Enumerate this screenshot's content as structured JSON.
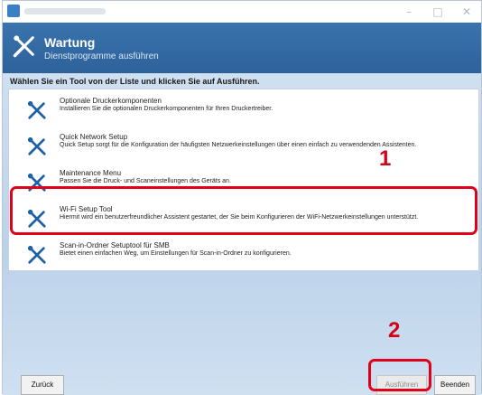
{
  "window": {
    "title": "",
    "minimize": "–",
    "maximize": "□",
    "close": "✕"
  },
  "header": {
    "title": "Wartung",
    "subtitle": "Dienstprogramme ausführen",
    "icon": "wrench-screwdriver-icon"
  },
  "prompt": "Wählen Sie ein Tool von der Liste und klicken Sie auf Ausführen.",
  "tools": [
    {
      "name": "Optionale Druckerkomponenten",
      "desc": "Installieren Sie die optionalen Druckerkomponenten für Ihren Druckertreiber."
    },
    {
      "name": "Quick Network Setup",
      "desc": "Quick Setup sorgt für die Konfiguration der häufigsten Netzwerkeinstellungen über einen einfach zu verwendenden Assistenten."
    },
    {
      "name": "Maintenance Menu",
      "desc": "Passen Sie die Druck- und Scaneinstellungen des Geräts an."
    },
    {
      "name": "Wi-Fi Setup Tool",
      "desc": "Hiermit wird ein benutzerfreundlicher Assistent gestartet, der Sie beim Konfigurieren der WiFi-Netzwerkeinstellungen unterstützt."
    },
    {
      "name": "Scan-in-Ordner Setuptool für SMB",
      "desc": "Bietet einen einfachen Weg, um Einstellungen für Scan-in-Ordner zu konfigurieren."
    }
  ],
  "callouts": {
    "one": "1",
    "two": "2"
  },
  "buttons": {
    "back": "Zurück",
    "execute": "Ausführen",
    "finish": "Beenden"
  },
  "colors": {
    "header": "#2d619a",
    "accent_icon": "#1f5fa8",
    "highlight": "#e0001a"
  }
}
